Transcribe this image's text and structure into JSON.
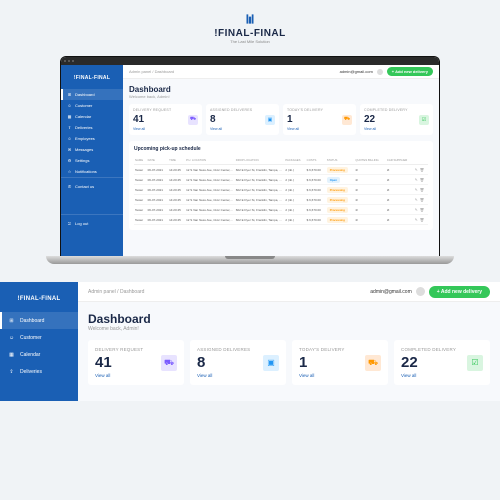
{
  "brand": {
    "name": "!FINAL-FINAL",
    "tagline": "The Last Mile Solution"
  },
  "topbar": {
    "breadcrumb": "Admin panel / Dashboard",
    "email": "admin@gmail.com",
    "add_btn": "+ Add new delivery"
  },
  "page": {
    "title": "Dashboard",
    "subtitle": "Welcome back, Admin!"
  },
  "nav": [
    {
      "icon": "⊞",
      "label": "Dashboard",
      "active": true
    },
    {
      "icon": "☺",
      "label": "Customer"
    },
    {
      "icon": "▦",
      "label": "Calendar"
    },
    {
      "icon": "⇪",
      "label": "Deliveries"
    },
    {
      "icon": "☺",
      "label": "Employees"
    },
    {
      "icon": "✉",
      "label": "Messages"
    },
    {
      "icon": "⚙",
      "label": "Settings"
    },
    {
      "icon": "☆",
      "label": "Notifications"
    }
  ],
  "nav_bottom": [
    {
      "icon": "✆",
      "label": "Contact us"
    }
  ],
  "nav_footer": [
    {
      "icon": "⎋",
      "label": "Log out"
    }
  ],
  "stats": [
    {
      "label": "DELIVERY REQUEST",
      "value": "41",
      "link": "View all",
      "icon": "⛟",
      "cls": "si1"
    },
    {
      "label": "ASSIGNED DELIVERES",
      "value": "8",
      "link": "View all",
      "icon": "▣",
      "cls": "si2"
    },
    {
      "label": "TODAY'S DELIVERY",
      "value": "1",
      "link": "View all",
      "icon": "⛟",
      "cls": "si3"
    },
    {
      "label": "COMPLETED DELIVERY",
      "value": "22",
      "link": "View all",
      "icon": "☑",
      "cls": "si4"
    }
  ],
  "table": {
    "title": "Upcoming pick-up schedule",
    "headers": [
      "NAME",
      "DATE",
      "TIME",
      "P.U. LOCATION",
      "DROP LOCATION",
      "PACKAGES",
      "COSTS",
      "STATUS",
      "QUOTES BILLING",
      "CAR SUPPLIER",
      ""
    ],
    "rows": [
      {
        "name": "Tester",
        "date": "06-07-2021",
        "time": "14:20:45",
        "pu": "12 S Van Ness Ave, Civic Center, San Francisco, 94103, CA, US",
        "drop": "602 E Dyer St, Franklin, Tampa, 33604, FL, US",
        "pkg": "2 (nb.)",
        "cost": "$ 6,670.00",
        "status": "Processing",
        "quotes": "⊘",
        "car": "⊘"
      },
      {
        "name": "Tester",
        "date": "06-07-2021",
        "time": "14:20:45",
        "pu": "12 S Van Ness Ave, Civic Center, San Francisco, 94103, CA, US",
        "drop": "602 E Dyer St, Franklin, Tampa, 33604, FL, US",
        "pkg": "2 (nb.)",
        "cost": "$ 6,670.00",
        "status": "Open",
        "quotes": "⊘",
        "car": "⊘"
      },
      {
        "name": "Tester",
        "date": "06-07-2021",
        "time": "14:20:45",
        "pu": "12 S Van Ness Ave, Civic Center, San Francisco, 94103, CA, US",
        "drop": "602 E Dyer St, Franklin, Tampa, 33604, FL, US",
        "pkg": "2 (nb.)",
        "cost": "$ 6,670.00",
        "status": "Processing",
        "quotes": "⊘",
        "car": "⊘"
      },
      {
        "name": "Tester",
        "date": "06-07-2021",
        "time": "14:20:45",
        "pu": "12 S Van Ness Ave, Civic Center, San Francisco, 94103, CA, US",
        "drop": "602 E Dyer St, Franklin, Tampa, 33604, FL, US",
        "pkg": "2 (nb.)",
        "cost": "$ 6,670.00",
        "status": "Processing",
        "quotes": "⊘",
        "car": "⊘"
      },
      {
        "name": "Tester",
        "date": "06-07-2021",
        "time": "14:20:45",
        "pu": "12 S Van Ness Ave, Civic Center, San Francisco, 94103, CA, US",
        "drop": "602 E Dyer St, Franklin, Tampa, 33604, FL, US",
        "pkg": "2 (nb.)",
        "cost": "$ 6,670.00",
        "status": "Processing",
        "quotes": "⊘",
        "car": "⊘"
      },
      {
        "name": "Tester",
        "date": "06-07-2021",
        "time": "14:20:45",
        "pu": "12 S Van Ness Ave, Civic Center, San Francisco, 94103, CA, US",
        "drop": "602 E Dyer St, Franklin, Tampa, 33604, FL, US",
        "pkg": "2 (nb.)",
        "cost": "$ 6,670.00",
        "status": "Processing",
        "quotes": "⊘",
        "car": "⊘"
      }
    ]
  }
}
